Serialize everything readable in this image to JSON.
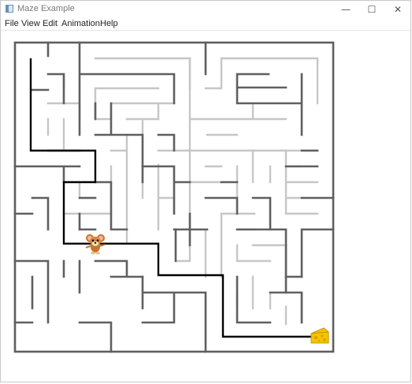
{
  "window": {
    "title": "Maze Example",
    "icon": "app-window-icon",
    "controls": {
      "minimize": "—",
      "maximize": "☐",
      "close": "✕"
    }
  },
  "menu": {
    "file": "File",
    "view": "View",
    "edit": "Edit",
    "animation": "Animation",
    "help": "Help"
  },
  "maze": {
    "wall_color": "#5f5f5f",
    "faded_wall_color": "#c6c6c6",
    "path_color": "#000000",
    "characters": {
      "mouse": "mouse-icon",
      "goal": "cheese-icon"
    }
  }
}
